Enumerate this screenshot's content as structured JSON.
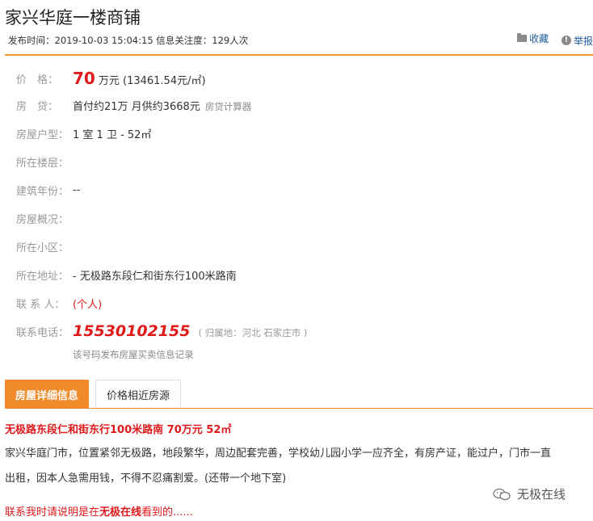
{
  "header": {
    "title": "家兴华庭一楼商铺",
    "meta": "发布时间：2019-10-03 15:04:15 信息关注度：129人次",
    "favorite_label": "收藏",
    "report_label": "举报"
  },
  "info": {
    "price_label": "价　格：",
    "price_value": "70",
    "price_unit": "万元",
    "price_per_sqm": "(13461.54元/㎡)",
    "loan_label": "房　贷：",
    "loan_value": "首付约21万 月供约3668元",
    "loan_calc": "房贷计算器",
    "layout_label": "房屋户型：",
    "layout_value": "1 室 1 卫 - 52㎡",
    "floor_label": "所在楼层：",
    "floor_value": "",
    "year_label": "建筑年份：",
    "year_value": "--",
    "overview_label": "房屋概况：",
    "overview_value": "",
    "community_label": "所在小区：",
    "community_value": "",
    "address_label": "所在地址：",
    "address_value": "- 无极路东段仁和街东行100米路南",
    "contact_label": "联 系 人：",
    "contact_value": "(个人)",
    "phone_label": "联系电话：",
    "phone_value": "15530102155",
    "phone_origin": "( 归属地：河北 石家庄市 )",
    "phone_note": "该号码发布房屋买卖信息记录"
  },
  "tabs": {
    "active": "房屋详细信息",
    "inactive": "价格相近房源"
  },
  "description": {
    "title": "无极路东段仁和街东行100米路南 70万元 52㎡",
    "line1": "家兴华庭门市，位置紧邻无极路，地段繁华，周边配套完善，学校幼儿园小学一应齐全，有房产证，能过户，门市一直",
    "line2": "出租，因本人急需用钱，不得不忍痛割爱。(还带一个地下室)",
    "tip_before": "联系我时请说明是在",
    "tip_bold": "无极在线",
    "tip_after": "看到的......"
  },
  "watermark": {
    "text": "无极在线"
  },
  "colors": {
    "accent_orange": "#f08a2b",
    "price_red": "#e0191b",
    "link_blue": "#1d5a9e"
  }
}
